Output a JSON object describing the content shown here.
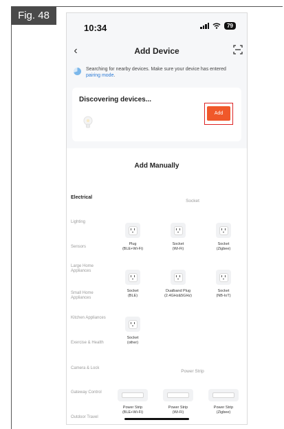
{
  "figure": {
    "label": "Fig. 48"
  },
  "status_bar": {
    "time": "10:34",
    "battery": "79"
  },
  "nav": {
    "back_icon": "back-chevron-icon",
    "title": "Add Device",
    "scan_icon": "scan-icon"
  },
  "search": {
    "text_before": "Searching for nearby devices. Make sure your device has entered ",
    "link_text": "pairing mode",
    "text_after": "."
  },
  "discover": {
    "title": "Discovering devices...",
    "add_label": "Add",
    "highlight_color": "#dd2222",
    "button_color": "#f0582a"
  },
  "manual": {
    "title": "Add Manually",
    "categories": [
      "Electrical",
      "Lighting",
      "Sensors",
      "Large Home Appliances",
      "Small Home Appliances",
      "Kitchen Appliances",
      "Exercise & Health",
      "Camera & Lock",
      "Gateway Control",
      "Outdoor Travel"
    ],
    "socket_section": "Socket",
    "sockets": [
      {
        "name": "Plug\n(BLE+Wi-Fi)"
      },
      {
        "name": "Socket\n(Wi-Fi)"
      },
      {
        "name": "Socket\n(Zigbee)"
      },
      {
        "name": "Socket\n(BLE)"
      },
      {
        "name": "Dualband Plug\n(2.4GHz&5GHz)"
      },
      {
        "name": "Socket\n(NB-IoT)"
      },
      {
        "name": "Socket\n(other)"
      }
    ],
    "strip_section": "Power Strip",
    "strips": [
      {
        "name": "Power Strip\n(BLE+Wi-Fi)"
      },
      {
        "name": "Power Strip\n(Wi-Fi)"
      },
      {
        "name": "Power Strip\n(Zigbee)"
      }
    ]
  }
}
